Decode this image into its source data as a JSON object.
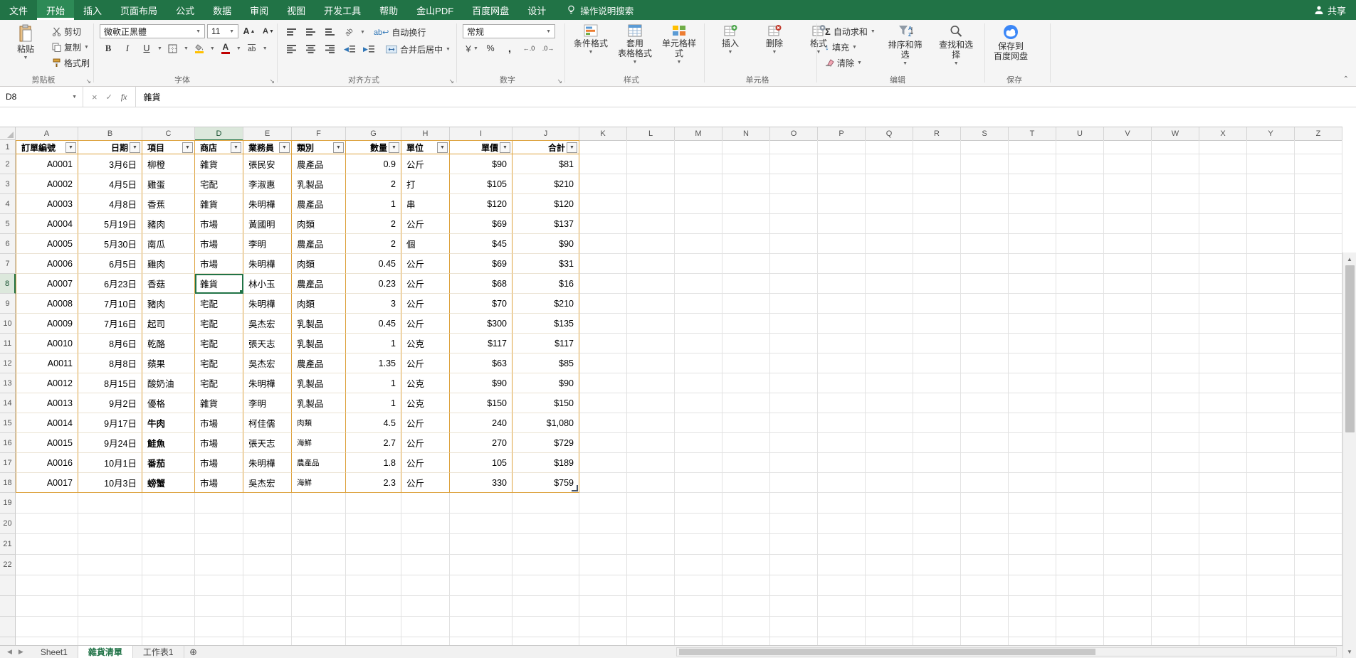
{
  "menu": {
    "tabs": [
      "文件",
      "开始",
      "插入",
      "页面布局",
      "公式",
      "数据",
      "审阅",
      "视图",
      "开发工具",
      "帮助",
      "金山PDF",
      "百度网盘",
      "设计"
    ],
    "active_tab": "开始",
    "search_label": "操作说明搜索",
    "share_label": "共享"
  },
  "ribbon": {
    "clipboard": {
      "group_label": "剪贴板",
      "paste": "粘贴",
      "cut": "剪切",
      "copy": "复制",
      "format_painter": "格式刷"
    },
    "font": {
      "group_label": "字体",
      "font_name": "微軟正黑體",
      "font_size": "11"
    },
    "alignment": {
      "group_label": "对齐方式",
      "wrap_text": "自动换行",
      "merge_center": "合并后居中"
    },
    "number": {
      "group_label": "数字",
      "format": "常规"
    },
    "styles": {
      "group_label": "样式",
      "conditional": "条件格式",
      "format_as_table": "套用\n表格格式",
      "cell_styles": "单元格样式"
    },
    "cells": {
      "group_label": "单元格",
      "insert": "插入",
      "delete": "删除",
      "format": "格式"
    },
    "editing": {
      "group_label": "编辑",
      "autosum": "自动求和",
      "fill": "填充",
      "clear": "清除",
      "sort_filter": "排序和筛选",
      "find_select": "查找和选择"
    },
    "save": {
      "group_label": "保存",
      "baidu_save": "保存到\n百度网盘"
    }
  },
  "formula_bar": {
    "name_box": "D8",
    "fx_label": "fx",
    "value": "雜貨"
  },
  "grid": {
    "columns": [
      "A",
      "B",
      "C",
      "D",
      "E",
      "F",
      "G",
      "H",
      "I",
      "J",
      "K",
      "L",
      "M",
      "N",
      "O",
      "P",
      "Q",
      "R",
      "S",
      "T",
      "U",
      "V",
      "W",
      "X",
      "Y",
      "Z"
    ],
    "row_numbers": [
      "1",
      "2",
      "3",
      "4",
      "5",
      "6",
      "7",
      "8",
      "9",
      "10",
      "11",
      "12",
      "13",
      "14",
      "15",
      "16",
      "17",
      "18",
      "19",
      "20",
      "21",
      "22"
    ],
    "selected_cell": "D8"
  },
  "table": {
    "headers": [
      "訂單編號",
      "日期",
      "項目",
      "商店",
      "業務員",
      "類別",
      "數量",
      "單位",
      "單價",
      "合計"
    ],
    "rows": [
      [
        "2",
        "A0001",
        "3月6日",
        "柳橙",
        "雜貨",
        "張民安",
        "農產品",
        "0.9",
        "公斤",
        "$90",
        "$81"
      ],
      [
        "3",
        "A0002",
        "4月5日",
        "雞蛋",
        "宅配",
        "李淑惠",
        "乳製品",
        "2",
        "打",
        "$105",
        "$210"
      ],
      [
        "4",
        "A0003",
        "4月8日",
        "香蕉",
        "雜貨",
        "朱明樺",
        "農產品",
        "1",
        "串",
        "$120",
        "$120"
      ],
      [
        "5",
        "A0004",
        "5月19日",
        "豬肉",
        "市場",
        "黃國明",
        "肉類",
        "2",
        "公斤",
        "$69",
        "$137"
      ],
      [
        "6",
        "A0005",
        "5月30日",
        "南瓜",
        "市場",
        "李明",
        "農產品",
        "2",
        "個",
        "$45",
        "$90"
      ],
      [
        "7",
        "A0006",
        "6月5日",
        "雞肉",
        "市場",
        "朱明樺",
        "肉類",
        "0.45",
        "公斤",
        "$69",
        "$31"
      ],
      [
        "8",
        "A0007",
        "6月23日",
        "香菇",
        "雜貨",
        "林小玉",
        "農產品",
        "0.23",
        "公斤",
        "$68",
        "$16"
      ],
      [
        "9",
        "A0008",
        "7月10日",
        "豬肉",
        "宅配",
        "朱明樺",
        "肉類",
        "3",
        "公斤",
        "$70",
        "$210"
      ],
      [
        "10",
        "A0009",
        "7月16日",
        "起司",
        "宅配",
        "吳杰宏",
        "乳製品",
        "0.45",
        "公斤",
        "$300",
        "$135"
      ],
      [
        "11",
        "A0010",
        "8月6日",
        "乾酪",
        "宅配",
        "張天志",
        "乳製品",
        "1",
        "公克",
        "$117",
        "$117"
      ],
      [
        "12",
        "A0011",
        "8月8日",
        "蘋果",
        "宅配",
        "吳杰宏",
        "農產品",
        "1.35",
        "公斤",
        "$63",
        "$85"
      ],
      [
        "13",
        "A0012",
        "8月15日",
        "酸奶油",
        "宅配",
        "朱明樺",
        "乳製品",
        "1",
        "公克",
        "$90",
        "$90"
      ],
      [
        "14",
        "A0013",
        "9月2日",
        "優格",
        "雜貨",
        "李明",
        "乳製品",
        "1",
        "公克",
        "$150",
        "$150"
      ],
      [
        "15",
        "A0014",
        "9月17日",
        "牛肉",
        "市場",
        "柯佳儒",
        "肉類",
        "4.5",
        "公斤",
        "240",
        "$1,080"
      ],
      [
        "16",
        "A0015",
        "9月24日",
        "鮭魚",
        "市場",
        "張天志",
        "海鮮",
        "2.7",
        "公斤",
        "270",
        "$729"
      ],
      [
        "17",
        "A0016",
        "10月1日",
        "番茄",
        "市場",
        "朱明樺",
        "農產品",
        "1.8",
        "公斤",
        "105",
        "$189"
      ],
      [
        "18",
        "A0017",
        "10月3日",
        "螃蟹",
        "市場",
        "吳杰宏",
        "海鮮",
        "2.3",
        "公斤",
        "330",
        "$759"
      ]
    ]
  },
  "sheet_bar": {
    "tabs": [
      "Sheet1",
      "雜貨清單",
      "工作表1"
    ],
    "active_tab": "雜貨清單"
  },
  "colors": {
    "theme_green": "#217346",
    "table_border": "#dda23e",
    "selection_green": "#217346"
  }
}
